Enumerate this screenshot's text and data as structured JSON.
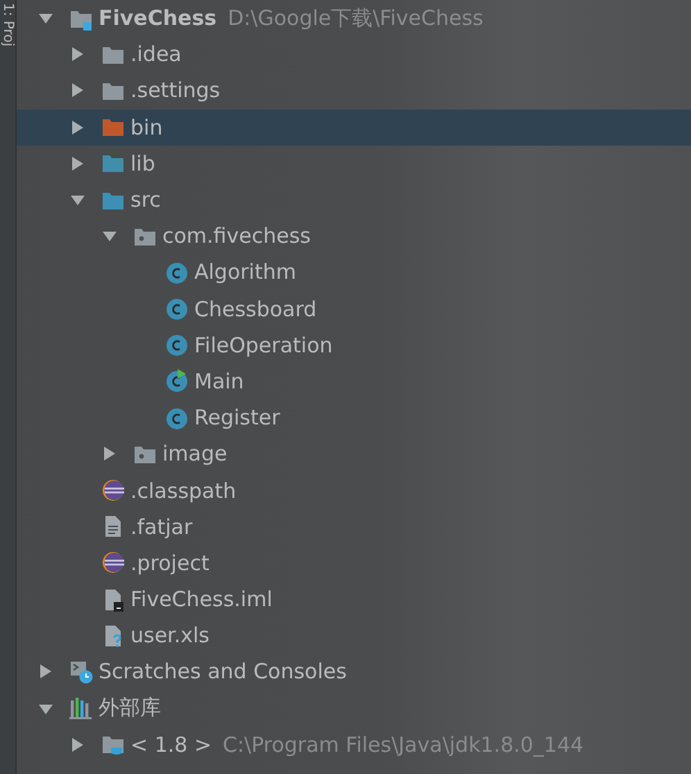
{
  "side_tab": {
    "label": "1: Proj"
  },
  "tree": [
    {
      "label": "FiveChess",
      "path": "D:\\Google下载\\FiveChess",
      "kind": "project",
      "expanded": true,
      "selected": false,
      "children": [
        {
          "label": ".idea",
          "kind": "folder",
          "expanded": false,
          "selected": false
        },
        {
          "label": ".settings",
          "kind": "folder",
          "expanded": false,
          "selected": false
        },
        {
          "label": "bin",
          "kind": "excluded",
          "expanded": false,
          "selected": true
        },
        {
          "label": "lib",
          "kind": "library",
          "expanded": false,
          "selected": false
        },
        {
          "label": "src",
          "kind": "source",
          "expanded": true,
          "selected": false,
          "children": [
            {
              "label": "com.fivechess",
              "kind": "package",
              "expanded": true,
              "selected": false,
              "children": [
                {
                  "label": "Algorithm",
                  "kind": "class",
                  "selected": false
                },
                {
                  "label": "Chessboard",
                  "kind": "class",
                  "selected": false
                },
                {
                  "label": "FileOperation",
                  "kind": "class",
                  "selected": false
                },
                {
                  "label": "Main",
                  "kind": "main",
                  "selected": false
                },
                {
                  "label": "Register",
                  "kind": "class",
                  "selected": false
                }
              ]
            },
            {
              "label": "image",
              "kind": "package",
              "expanded": false,
              "selected": false
            }
          ]
        },
        {
          "label": ".classpath",
          "kind": "eclipse",
          "selected": false
        },
        {
          "label": ".fatjar",
          "kind": "text",
          "selected": false
        },
        {
          "label": ".project",
          "kind": "eclipse",
          "selected": false
        },
        {
          "label": "FiveChess.iml",
          "kind": "iml",
          "selected": false
        },
        {
          "label": "user.xls",
          "kind": "unknown",
          "selected": false
        }
      ]
    },
    {
      "label": "Scratches and Consoles",
      "kind": "scratches",
      "expanded": false,
      "selected": false
    },
    {
      "label": "外部库",
      "kind": "libraries",
      "expanded": true,
      "selected": false,
      "children": [
        {
          "label": "< 1.8 >",
          "path": "C:\\Program Files\\Java\\jdk1.8.0_144",
          "kind": "jdk",
          "expanded": false,
          "selected": false
        }
      ]
    }
  ]
}
